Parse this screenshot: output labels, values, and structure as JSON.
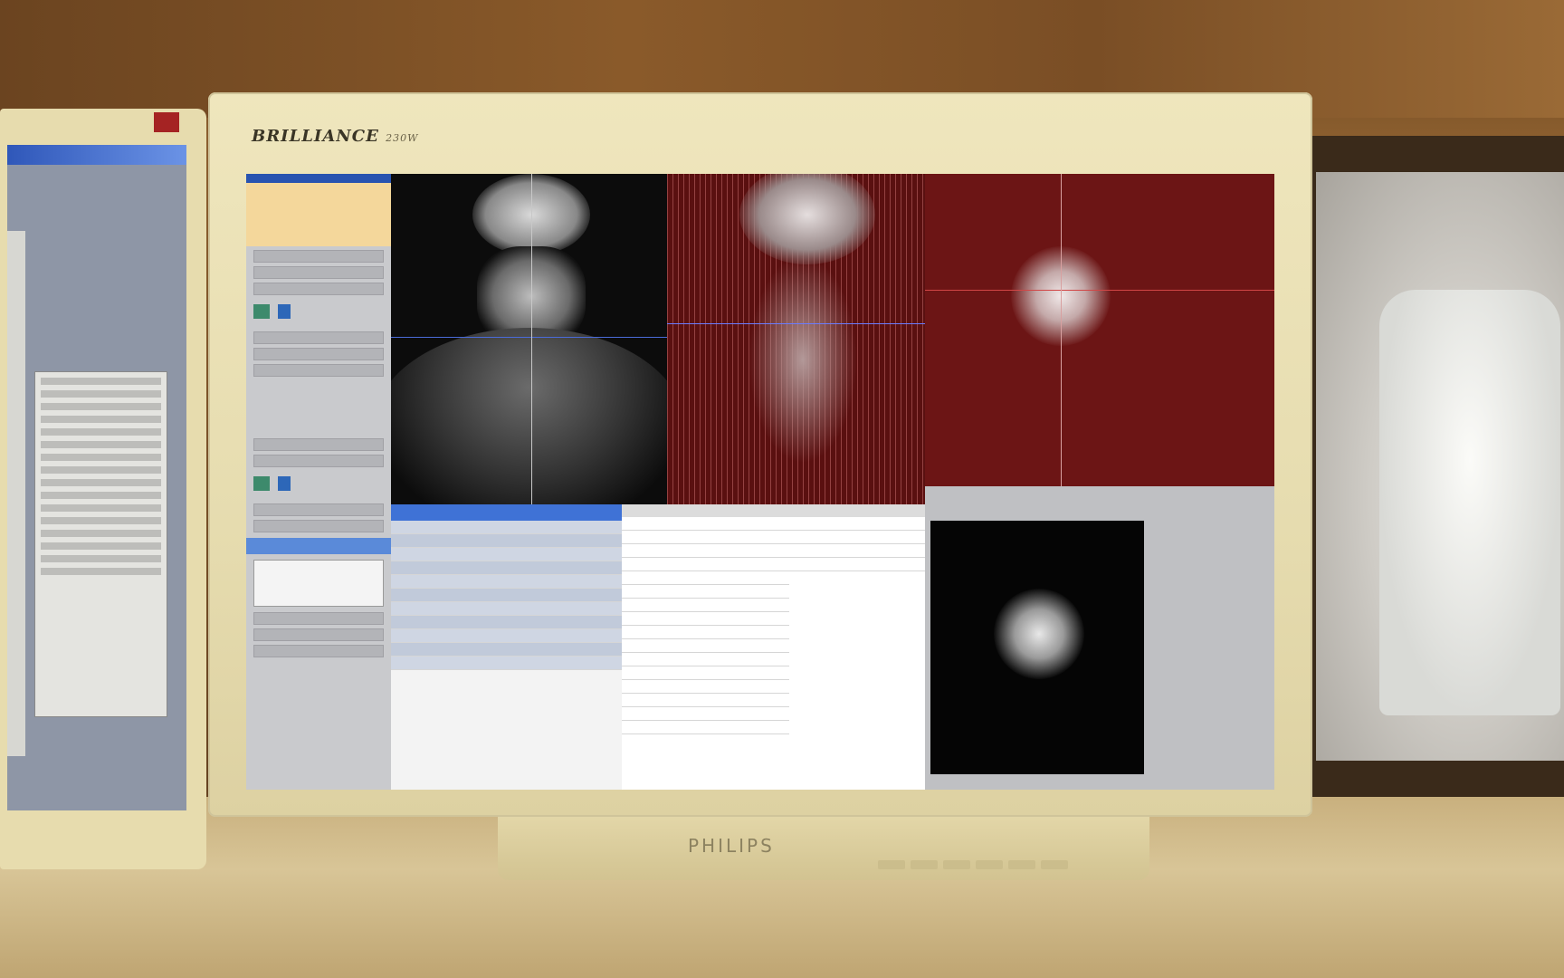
{
  "scene": {
    "main_monitor": {
      "brand": "BRILLIANCE",
      "brand_suffix": "230W",
      "maker": "PHILIPS"
    }
  },
  "colors": {
    "bezel": "#e6dcaf",
    "wall": "#7a4e25",
    "selection_blue": "#3f72d6",
    "study_header": "#f4d79b",
    "sagittal_tint": "#5a1010"
  }
}
